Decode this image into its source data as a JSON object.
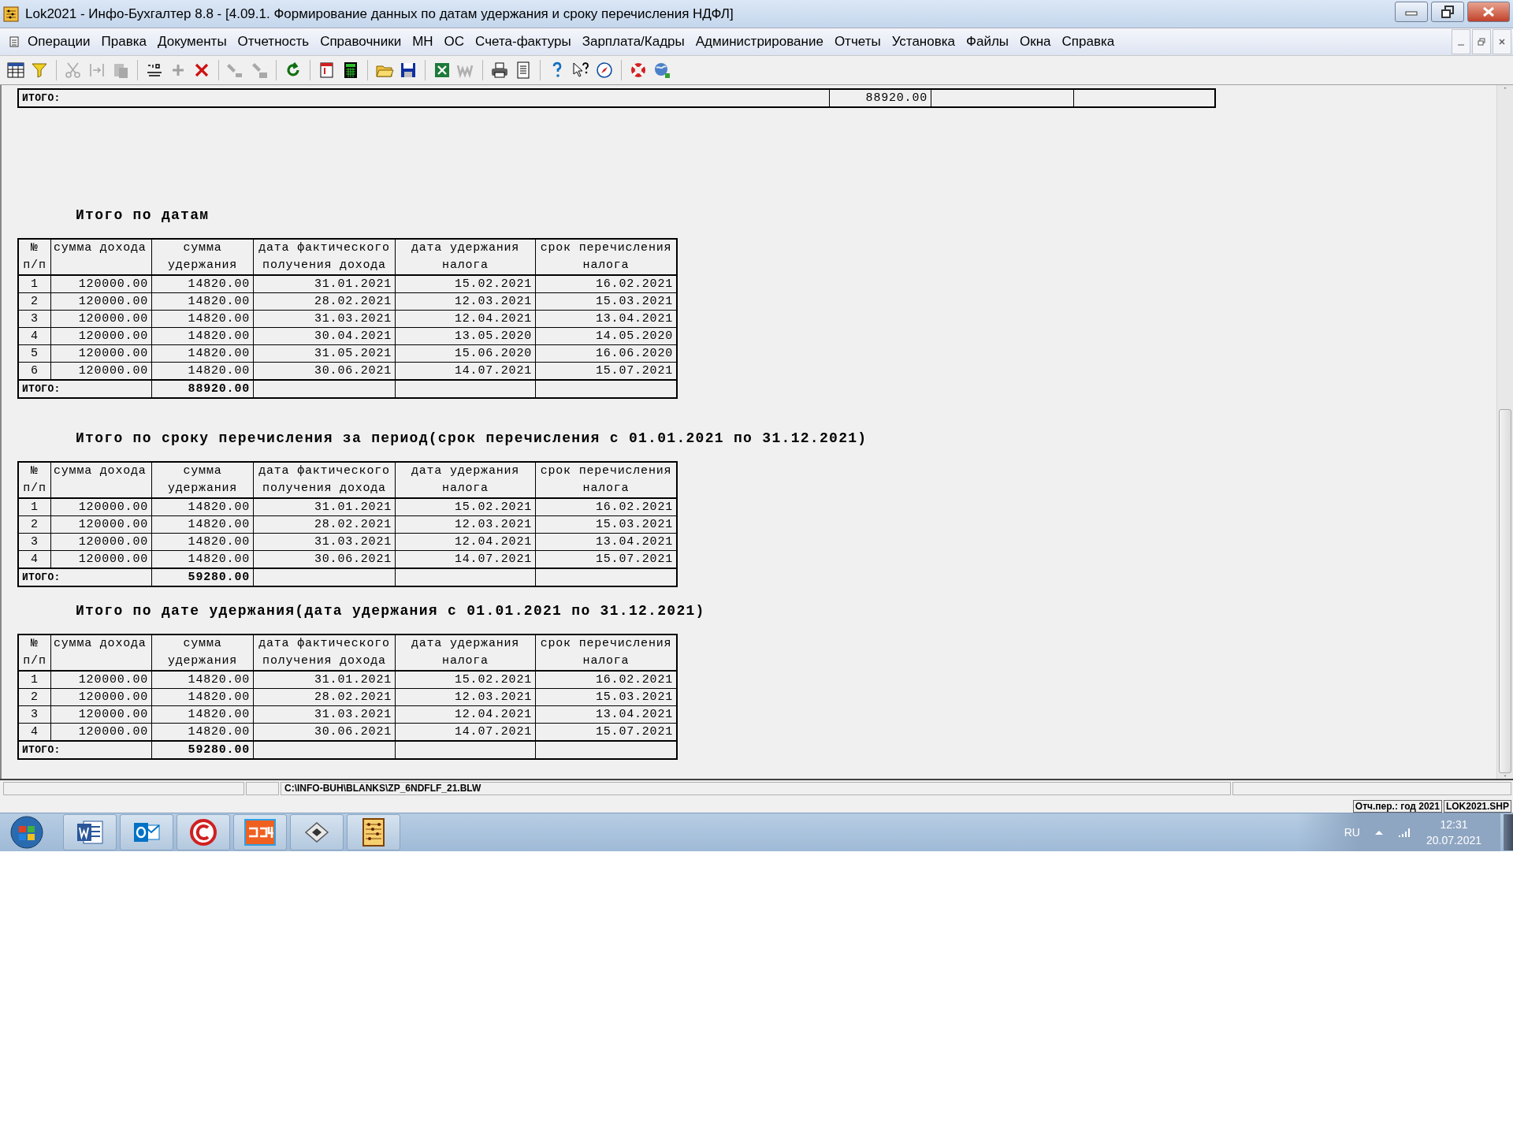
{
  "window": {
    "title": "Lok2021 - Инфо-Бухгалтер 8.8 - [4.09.1. Формирование данных по датам удержания и сроку перечисления НДФЛ]"
  },
  "menu": [
    "Операции",
    "Правка",
    "Документы",
    "Отчетность",
    "Справочники",
    "МН",
    "ОС",
    "Счета-фактуры",
    "Зарплата/Кадры",
    "Администрирование",
    "Отчеты",
    "Установка",
    "Файлы",
    "Окна",
    "Справка"
  ],
  "top_total": {
    "label": "ИТОГО:",
    "value": "88920.00"
  },
  "sections": [
    {
      "title": "Итого по датам",
      "columns": [
        "№ п/п",
        "сумма дохода",
        "сумма удержания",
        "дата фактического получения дохода",
        "дата удержания налога",
        "срок перечисления налога"
      ],
      "rows": [
        [
          "1",
          "120000.00",
          "14820.00",
          "31.01.2021",
          "15.02.2021",
          "16.02.2021"
        ],
        [
          "2",
          "120000.00",
          "14820.00",
          "28.02.2021",
          "12.03.2021",
          "15.03.2021"
        ],
        [
          "3",
          "120000.00",
          "14820.00",
          "31.03.2021",
          "12.04.2021",
          "13.04.2021"
        ],
        [
          "4",
          "120000.00",
          "14820.00",
          "30.04.2021",
          "13.05.2020",
          "14.05.2020"
        ],
        [
          "5",
          "120000.00",
          "14820.00",
          "31.05.2021",
          "15.06.2020",
          "16.06.2020"
        ],
        [
          "6",
          "120000.00",
          "14820.00",
          "30.06.2021",
          "14.07.2021",
          "15.07.2021"
        ]
      ],
      "total": {
        "label": "ИТОГО:",
        "value": "88920.00"
      }
    },
    {
      "title": "Итого по сроку перечисления за период(срок перечисления с 01.01.2021 по 31.12.2021)",
      "columns": [
        "№ п/п",
        "сумма дохода",
        "сумма удержания",
        "дата фактического получения дохода",
        "дата удержания налога",
        "срок перечисления налога"
      ],
      "rows": [
        [
          "1",
          "120000.00",
          "14820.00",
          "31.01.2021",
          "15.02.2021",
          "16.02.2021"
        ],
        [
          "2",
          "120000.00",
          "14820.00",
          "28.02.2021",
          "12.03.2021",
          "15.03.2021"
        ],
        [
          "3",
          "120000.00",
          "14820.00",
          "31.03.2021",
          "12.04.2021",
          "13.04.2021"
        ],
        [
          "4",
          "120000.00",
          "14820.00",
          "30.06.2021",
          "14.07.2021",
          "15.07.2021"
        ]
      ],
      "total": {
        "label": "ИТОГО:",
        "value": "59280.00"
      }
    },
    {
      "title": "Итого по дате удержания(дата удержания с 01.01.2021 по 31.12.2021)",
      "columns": [
        "№ п/п",
        "сумма дохода",
        "сумма удержания",
        "дата фактического получения дохода",
        "дата удержания налога",
        "срок перечисления налога"
      ],
      "rows": [
        [
          "1",
          "120000.00",
          "14820.00",
          "31.01.2021",
          "15.02.2021",
          "16.02.2021"
        ],
        [
          "2",
          "120000.00",
          "14820.00",
          "28.02.2021",
          "12.03.2021",
          "15.03.2021"
        ],
        [
          "3",
          "120000.00",
          "14820.00",
          "31.03.2021",
          "12.04.2021",
          "13.04.2021"
        ],
        [
          "4",
          "120000.00",
          "14820.00",
          "30.06.2021",
          "14.07.2021",
          "15.07.2021"
        ]
      ],
      "total": {
        "label": "ИТОГО:",
        "value": "59280.00"
      }
    }
  ],
  "status_bar": {
    "path": "C:\\INFO-BUH\\BLANKS\\ZP_6NDFLF_21.BLW",
    "period": "Отч.пер.: год 2021",
    "file": "LOK2021.SHP"
  },
  "taskbar": {
    "language": "RU",
    "time": "12:31",
    "date": "20.07.2021"
  }
}
